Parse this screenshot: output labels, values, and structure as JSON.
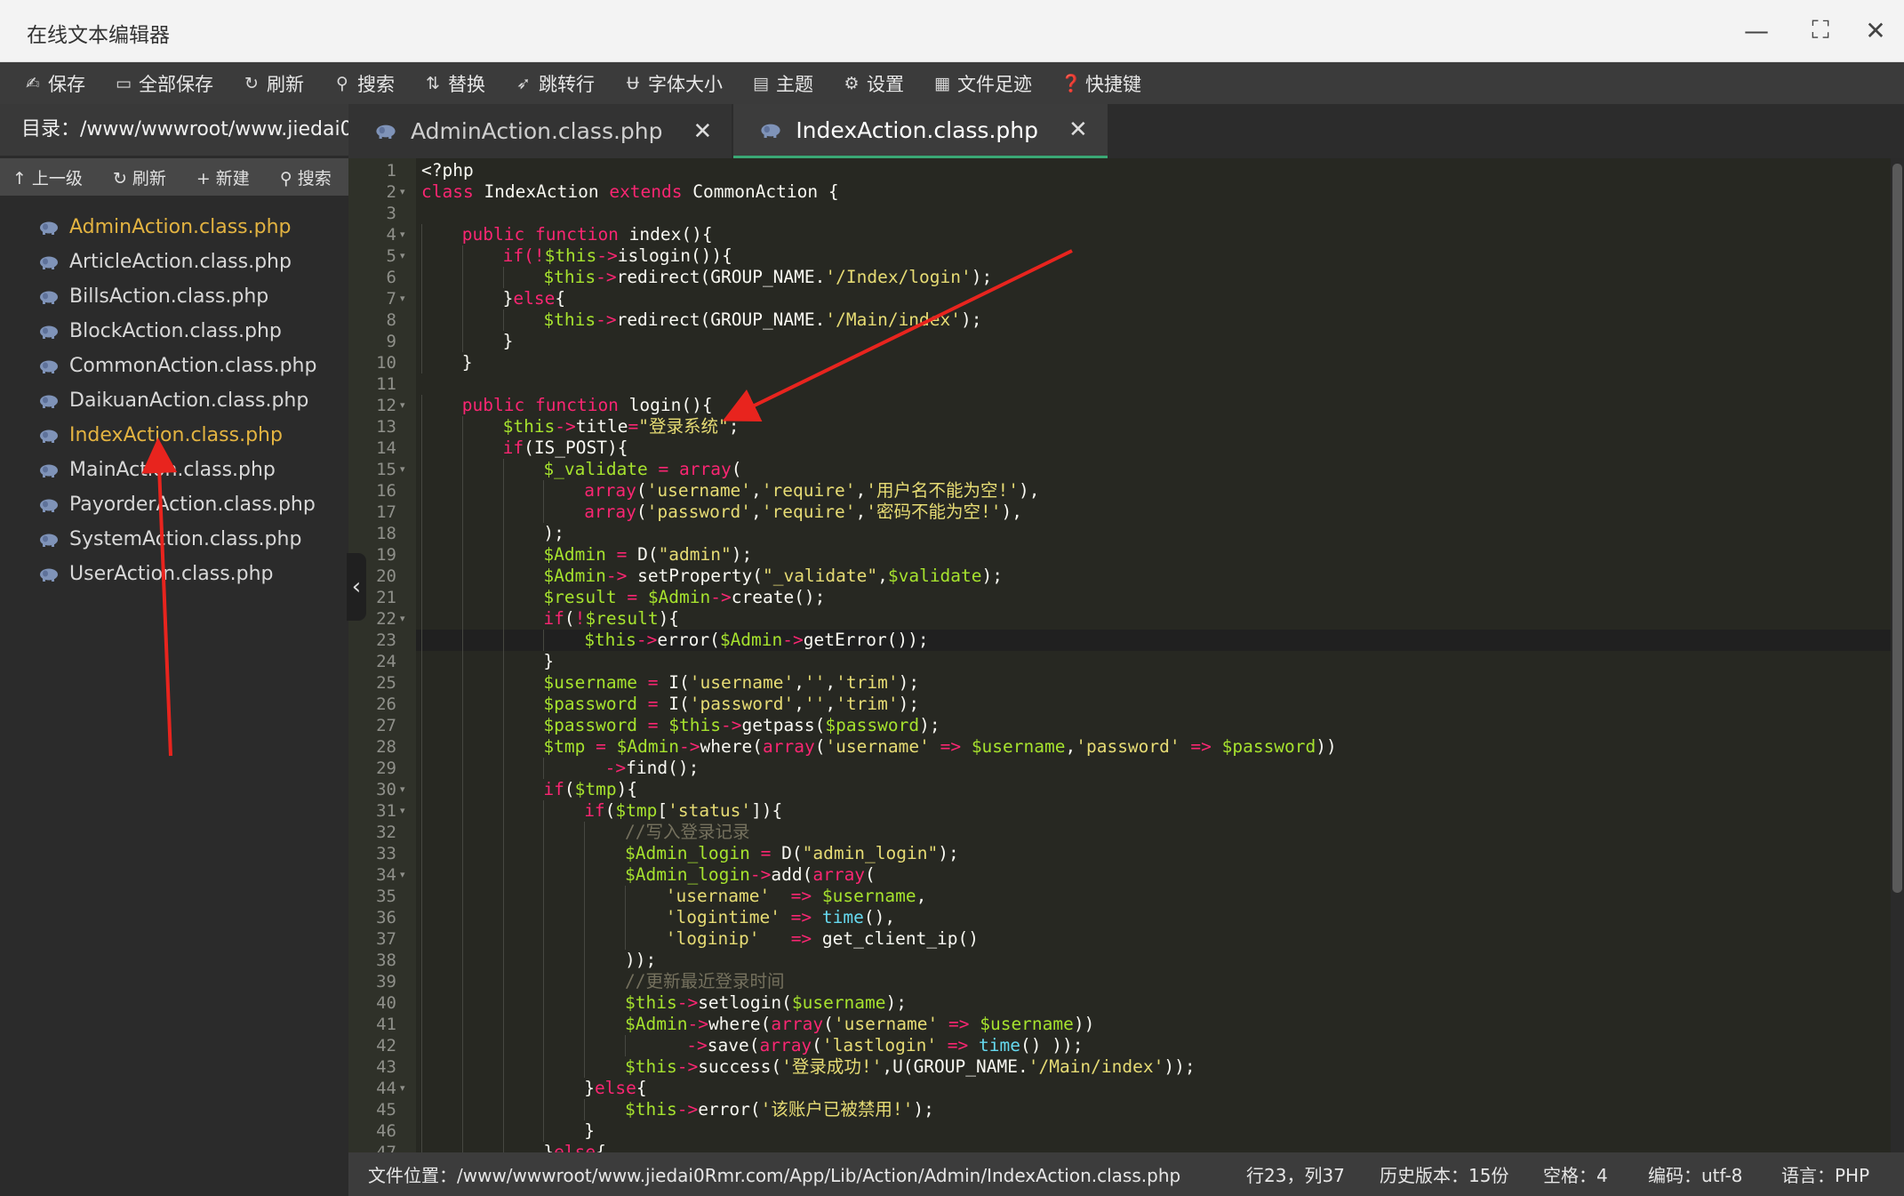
{
  "window": {
    "title": "在线文本编辑器"
  },
  "toolbar": [
    {
      "icon": "save-icon",
      "glyph": "✍",
      "label": "保存"
    },
    {
      "icon": "save-all-icon",
      "glyph": "▭",
      "label": "全部保存"
    },
    {
      "icon": "refresh-icon",
      "glyph": "↻",
      "label": "刷新"
    },
    {
      "icon": "search-icon",
      "glyph": "⚲",
      "label": "搜索"
    },
    {
      "icon": "replace-icon",
      "glyph": "⇅",
      "label": "替换"
    },
    {
      "icon": "goto-line-icon",
      "glyph": "➶",
      "label": "跳转行"
    },
    {
      "icon": "font-size-icon",
      "glyph": "Ʉ",
      "label": "字体大小"
    },
    {
      "icon": "theme-icon",
      "glyph": "▤",
      "label": "主题"
    },
    {
      "icon": "settings-icon",
      "glyph": "⚙",
      "label": "设置"
    },
    {
      "icon": "history-icon",
      "glyph": "▦",
      "label": "文件足迹"
    },
    {
      "icon": "help-icon",
      "glyph": "❓",
      "label": "快捷键"
    }
  ],
  "sidebar": {
    "directory": "目录：/www/wwwroot/www.jiedai0...",
    "tools": [
      {
        "icon": "up-arrow-icon",
        "glyph": "↑",
        "label": "上一级"
      },
      {
        "icon": "refresh-icon",
        "glyph": "↻",
        "label": "刷新"
      },
      {
        "icon": "plus-icon",
        "glyph": "+",
        "label": "新建"
      },
      {
        "icon": "search-icon",
        "glyph": "⚲",
        "label": "搜索"
      }
    ],
    "files": [
      {
        "name": "AdminAction.class.php",
        "active": true
      },
      {
        "name": "ArticleAction.class.php",
        "active": false
      },
      {
        "name": "BillsAction.class.php",
        "active": false
      },
      {
        "name": "BlockAction.class.php",
        "active": false
      },
      {
        "name": "CommonAction.class.php",
        "active": false
      },
      {
        "name": "DaikuanAction.class.php",
        "active": false
      },
      {
        "name": "IndexAction.class.php",
        "active": true
      },
      {
        "name": "MainAction.class.php",
        "active": false
      },
      {
        "name": "PayorderAction.class.php",
        "active": false
      },
      {
        "name": "SystemAction.class.php",
        "active": false
      },
      {
        "name": "UserAction.class.php",
        "active": false
      }
    ]
  },
  "tabs": [
    {
      "label": "AdminAction.class.php",
      "active": false
    },
    {
      "label": "IndexAction.class.php",
      "active": true
    }
  ],
  "editor": {
    "current_line": 23,
    "lines": [
      [
        [
          0,
          "<?php",
          "p"
        ]
      ],
      [
        [
          0,
          "class",
          "k"
        ],
        [
          0,
          " IndexAction ",
          "p"
        ],
        [
          0,
          "extends",
          "k"
        ],
        [
          0,
          " CommonAction {",
          "p"
        ]
      ],
      [],
      [
        [
          1,
          "public",
          "k"
        ],
        [
          1,
          " ",
          "p"
        ],
        [
          1,
          "function",
          "k"
        ],
        [
          1,
          " index(){",
          "p"
        ]
      ],
      [
        [
          2,
          "if(",
          "k"
        ],
        [
          2,
          "!",
          "o"
        ],
        [
          2,
          "$this",
          "v"
        ],
        [
          2,
          "->",
          "o"
        ],
        [
          2,
          "islogin()){",
          "p"
        ]
      ],
      [
        [
          3,
          "$this",
          "v"
        ],
        [
          3,
          "->",
          "o"
        ],
        [
          3,
          "redirect(GROUP_NAME.",
          "p"
        ],
        [
          3,
          "'/Index/login'",
          "s"
        ],
        [
          3,
          ");",
          "p"
        ]
      ],
      [
        [
          2,
          "}",
          "p"
        ],
        [
          2,
          "else",
          "k"
        ],
        [
          2,
          "{",
          "p"
        ]
      ],
      [
        [
          3,
          "$this",
          "v"
        ],
        [
          3,
          "->",
          "o"
        ],
        [
          3,
          "redirect(GROUP_NAME.",
          "p"
        ],
        [
          3,
          "'/Main/index'",
          "s"
        ],
        [
          3,
          ");",
          "p"
        ]
      ],
      [
        [
          2,
          "}",
          "p"
        ]
      ],
      [
        [
          1,
          "}",
          "p"
        ]
      ],
      [],
      [
        [
          1,
          "public",
          "k"
        ],
        [
          1,
          " ",
          "p"
        ],
        [
          1,
          "function",
          "k"
        ],
        [
          1,
          " login(){",
          "p"
        ]
      ],
      [
        [
          2,
          "$this",
          "v"
        ],
        [
          2,
          "->",
          "o"
        ],
        [
          2,
          "title",
          "p"
        ],
        [
          2,
          "=",
          "o"
        ],
        [
          2,
          "\"登录系统\"",
          "s"
        ],
        [
          2,
          ";",
          "p"
        ]
      ],
      [
        [
          2,
          "if",
          "k"
        ],
        [
          2,
          "(IS_POST){",
          "p"
        ]
      ],
      [
        [
          3,
          "$_validate",
          "v"
        ],
        [
          3,
          " = ",
          "o"
        ],
        [
          3,
          "array",
          "k"
        ],
        [
          3,
          "(",
          "p"
        ]
      ],
      [
        [
          4,
          "array",
          "k"
        ],
        [
          4,
          "(",
          "p"
        ],
        [
          4,
          "'username'",
          "s"
        ],
        [
          4,
          ",",
          "p"
        ],
        [
          4,
          "'require'",
          "s"
        ],
        [
          4,
          ",",
          "p"
        ],
        [
          4,
          "'用户名不能为空!'",
          "s"
        ],
        [
          4,
          "),",
          "p"
        ]
      ],
      [
        [
          4,
          "array",
          "k"
        ],
        [
          4,
          "(",
          "p"
        ],
        [
          4,
          "'password'",
          "s"
        ],
        [
          4,
          ",",
          "p"
        ],
        [
          4,
          "'require'",
          "s"
        ],
        [
          4,
          ",",
          "p"
        ],
        [
          4,
          "'密码不能为空!'",
          "s"
        ],
        [
          4,
          "),",
          "p"
        ]
      ],
      [
        [
          3,
          ");",
          "p"
        ]
      ],
      [
        [
          3,
          "$Admin",
          "v"
        ],
        [
          3,
          " = ",
          "o"
        ],
        [
          3,
          "D(",
          "p"
        ],
        [
          3,
          "\"admin\"",
          "s"
        ],
        [
          3,
          ");",
          "p"
        ]
      ],
      [
        [
          3,
          "$Admin",
          "v"
        ],
        [
          3,
          "-> ",
          "o"
        ],
        [
          3,
          "setProperty(",
          "p"
        ],
        [
          3,
          "\"_validate\"",
          "s"
        ],
        [
          3,
          ",",
          "p"
        ],
        [
          3,
          "$validate",
          "v"
        ],
        [
          3,
          ");",
          "p"
        ]
      ],
      [
        [
          3,
          "$result",
          "v"
        ],
        [
          3,
          " = ",
          "o"
        ],
        [
          3,
          "$Admin",
          "v"
        ],
        [
          3,
          "->",
          "o"
        ],
        [
          3,
          "create();",
          "p"
        ]
      ],
      [
        [
          3,
          "if",
          "k"
        ],
        [
          3,
          "(",
          "p"
        ],
        [
          3,
          "!",
          "o"
        ],
        [
          3,
          "$result",
          "v"
        ],
        [
          3,
          "){",
          "p"
        ]
      ],
      [
        [
          4,
          "$this",
          "v"
        ],
        [
          4,
          "->",
          "o"
        ],
        [
          4,
          "error(",
          "p"
        ],
        [
          4,
          "$Admin",
          "v"
        ],
        [
          4,
          "->",
          "o"
        ],
        [
          4,
          "getError());",
          "p"
        ]
      ],
      [
        [
          3,
          "}",
          "p"
        ]
      ],
      [
        [
          3,
          "$username",
          "v"
        ],
        [
          3,
          " = ",
          "o"
        ],
        [
          3,
          "I(",
          "p"
        ],
        [
          3,
          "'username'",
          "s"
        ],
        [
          3,
          ",",
          "p"
        ],
        [
          3,
          "''",
          "s"
        ],
        [
          3,
          ",",
          "p"
        ],
        [
          3,
          "'trim'",
          "s"
        ],
        [
          3,
          ");",
          "p"
        ]
      ],
      [
        [
          3,
          "$password",
          "v"
        ],
        [
          3,
          " = ",
          "o"
        ],
        [
          3,
          "I(",
          "p"
        ],
        [
          3,
          "'password'",
          "s"
        ],
        [
          3,
          ",",
          "p"
        ],
        [
          3,
          "''",
          "s"
        ],
        [
          3,
          ",",
          "p"
        ],
        [
          3,
          "'trim'",
          "s"
        ],
        [
          3,
          ");",
          "p"
        ]
      ],
      [
        [
          3,
          "$password",
          "v"
        ],
        [
          3,
          " = ",
          "o"
        ],
        [
          3,
          "$this",
          "v"
        ],
        [
          3,
          "->",
          "o"
        ],
        [
          3,
          "getpass(",
          "p"
        ],
        [
          3,
          "$password",
          "v"
        ],
        [
          3,
          ");",
          "p"
        ]
      ],
      [
        [
          3,
          "$tmp",
          "v"
        ],
        [
          3,
          " = ",
          "o"
        ],
        [
          3,
          "$Admin",
          "v"
        ],
        [
          3,
          "->",
          "o"
        ],
        [
          3,
          "where(",
          "p"
        ],
        [
          3,
          "array",
          "k"
        ],
        [
          3,
          "(",
          "p"
        ],
        [
          3,
          "'username'",
          "s"
        ],
        [
          3,
          " => ",
          "o"
        ],
        [
          3,
          "$username",
          "v"
        ],
        [
          3,
          ",",
          "p"
        ],
        [
          3,
          "'password'",
          "s"
        ],
        [
          3,
          " => ",
          "o"
        ],
        [
          3,
          "$password",
          "v"
        ],
        [
          3,
          "))",
          "p"
        ]
      ],
      [
        [
          4,
          "  ->",
          "o"
        ],
        [
          4,
          "find();",
          "p"
        ]
      ],
      [
        [
          3,
          "if",
          "k"
        ],
        [
          3,
          "(",
          "p"
        ],
        [
          3,
          "$tmp",
          "v"
        ],
        [
          3,
          "){",
          "p"
        ]
      ],
      [
        [
          4,
          "if",
          "k"
        ],
        [
          4,
          "(",
          "p"
        ],
        [
          4,
          "$tmp",
          "v"
        ],
        [
          4,
          "[",
          "p"
        ],
        [
          4,
          "'status'",
          "s"
        ],
        [
          4,
          "]){",
          "p"
        ]
      ],
      [
        [
          5,
          "//写入登录记录",
          "cm"
        ]
      ],
      [
        [
          5,
          "$Admin_login",
          "v"
        ],
        [
          5,
          " = ",
          "o"
        ],
        [
          5,
          "D(",
          "p"
        ],
        [
          5,
          "\"admin_login\"",
          "s"
        ],
        [
          5,
          ");",
          "p"
        ]
      ],
      [
        [
          5,
          "$Admin_login",
          "v"
        ],
        [
          5,
          "->",
          "o"
        ],
        [
          5,
          "add(",
          "p"
        ],
        [
          5,
          "array",
          "k"
        ],
        [
          5,
          "(",
          "p"
        ]
      ],
      [
        [
          6,
          "'username'",
          "s"
        ],
        [
          6,
          "  => ",
          "o"
        ],
        [
          6,
          "$username",
          "v"
        ],
        [
          6,
          ",",
          "p"
        ]
      ],
      [
        [
          6,
          "'logintime'",
          "s"
        ],
        [
          6,
          " => ",
          "o"
        ],
        [
          6,
          "time",
          "b"
        ],
        [
          6,
          "(),",
          "p"
        ]
      ],
      [
        [
          6,
          "'loginip'",
          "s"
        ],
        [
          6,
          "   => ",
          "o"
        ],
        [
          6,
          "get_client_ip()",
          "p"
        ]
      ],
      [
        [
          5,
          "));",
          "p"
        ]
      ],
      [
        [
          5,
          "//更新最近登录时间",
          "cm"
        ]
      ],
      [
        [
          5,
          "$this",
          "v"
        ],
        [
          5,
          "->",
          "o"
        ],
        [
          5,
          "setlogin(",
          "p"
        ],
        [
          5,
          "$username",
          "v"
        ],
        [
          5,
          ");",
          "p"
        ]
      ],
      [
        [
          5,
          "$Admin",
          "v"
        ],
        [
          5,
          "->",
          "o"
        ],
        [
          5,
          "where(",
          "p"
        ],
        [
          5,
          "array",
          "k"
        ],
        [
          5,
          "(",
          "p"
        ],
        [
          5,
          "'username'",
          "s"
        ],
        [
          5,
          " => ",
          "o"
        ],
        [
          5,
          "$username",
          "v"
        ],
        [
          5,
          "))",
          "p"
        ]
      ],
      [
        [
          6,
          "  ->",
          "o"
        ],
        [
          6,
          "save(",
          "p"
        ],
        [
          6,
          "array",
          "k"
        ],
        [
          6,
          "(",
          "p"
        ],
        [
          6,
          "'lastlogin'",
          "s"
        ],
        [
          6,
          " => ",
          "o"
        ],
        [
          6,
          "time",
          "b"
        ],
        [
          6,
          "() ));",
          "p"
        ]
      ],
      [
        [
          5,
          "$this",
          "v"
        ],
        [
          5,
          "->",
          "o"
        ],
        [
          5,
          "success(",
          "p"
        ],
        [
          5,
          "'登录成功!'",
          "s"
        ],
        [
          5,
          ",U(GROUP_NAME.",
          "p"
        ],
        [
          5,
          "'/Main/index'",
          "s"
        ],
        [
          5,
          "));",
          "p"
        ]
      ],
      [
        [
          4,
          "}",
          "p"
        ],
        [
          4,
          "else",
          "k"
        ],
        [
          4,
          "{",
          "p"
        ]
      ],
      [
        [
          5,
          "$this",
          "v"
        ],
        [
          5,
          "->",
          "o"
        ],
        [
          5,
          "error(",
          "p"
        ],
        [
          5,
          "'该账户已被禁用!'",
          "s"
        ],
        [
          5,
          ");",
          "p"
        ]
      ],
      [
        [
          4,
          "}",
          "p"
        ]
      ],
      [
        [
          3,
          "}",
          "p"
        ],
        [
          3,
          "else",
          "k"
        ],
        [
          3,
          "{",
          "p"
        ]
      ]
    ],
    "fold_lines": [
      2,
      4,
      5,
      7,
      12,
      15,
      22,
      30,
      31,
      34,
      44
    ]
  },
  "statusbar": {
    "path": "文件位置：/www/wwwroot/www.jiedai0Rmr.com/App/Lib/Action/Admin/IndexAction.class.php",
    "position": "行23，列37",
    "history": "历史版本：15份",
    "indent": "空格：4",
    "encoding": "编码：utf-8",
    "language": "语言：PHP"
  },
  "colors": {
    "accent": "#3aa875",
    "active_file": "#e3b341",
    "annotation_arrow": "#e8241e"
  }
}
